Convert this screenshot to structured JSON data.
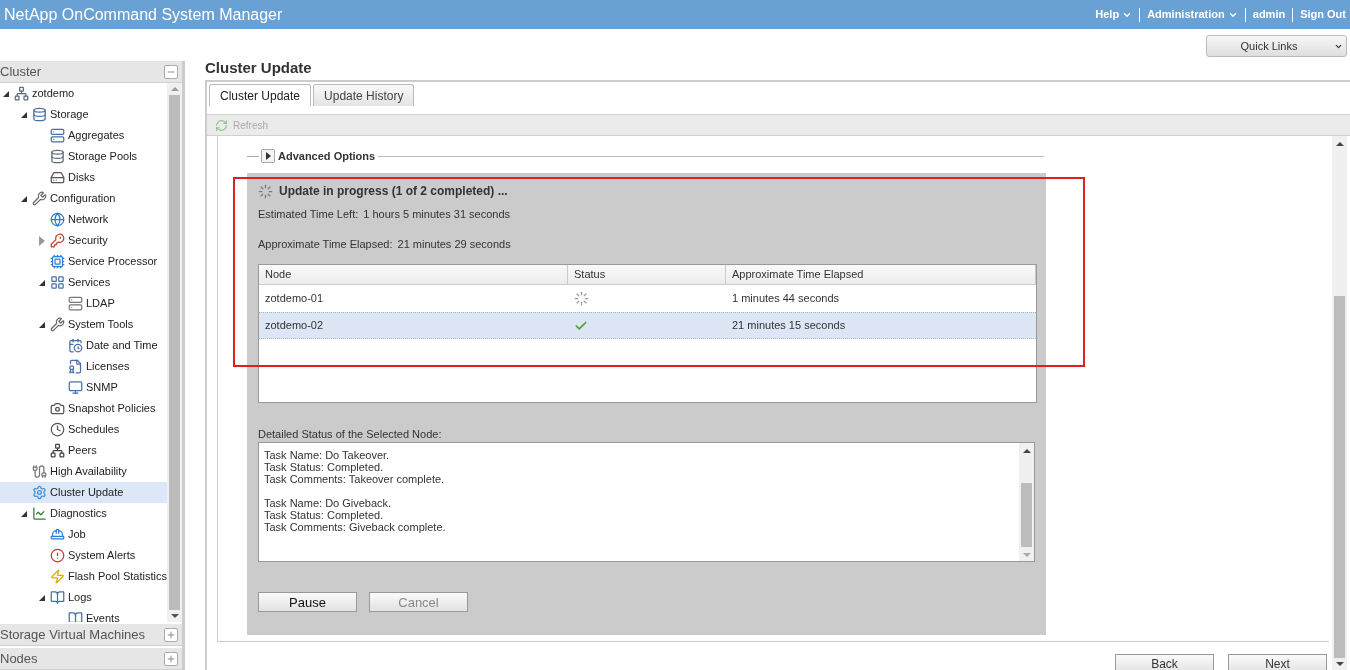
{
  "header": {
    "title": "NetApp OnCommand System Manager",
    "menus": [
      {
        "label": "Help",
        "dropdown": true
      },
      {
        "label": "Administration",
        "dropdown": true
      },
      {
        "label": "admin",
        "dropdown": false
      },
      {
        "label": "Sign Out",
        "dropdown": false
      }
    ]
  },
  "quick_links": {
    "label": "Quick Links"
  },
  "sidebar": {
    "sections": [
      {
        "title": "Cluster",
        "expanded": true
      },
      {
        "title": "Storage Virtual Machines",
        "expanded": false
      },
      {
        "title": "Nodes",
        "expanded": false
      }
    ],
    "tree": [
      {
        "label": "zotdemo",
        "selected": false,
        "expanded": true,
        "children": [
          {
            "label": "Storage",
            "selected": false,
            "expanded": true,
            "children": [
              {
                "label": "Aggregates",
                "selected": false
              },
              {
                "label": "Storage Pools",
                "selected": false
              },
              {
                "label": "Disks",
                "selected": false
              }
            ]
          },
          {
            "label": "Configuration",
            "selected": false,
            "expanded": true,
            "children": [
              {
                "label": "Network",
                "selected": false
              },
              {
                "label": "Security",
                "selected": false,
                "expanded": false
              },
              {
                "label": "Service Processor",
                "selected": false
              },
              {
                "label": "Services",
                "selected": false,
                "expanded": true,
                "children": [
                  {
                    "label": "LDAP",
                    "selected": false
                  }
                ]
              },
              {
                "label": "System Tools",
                "selected": false,
                "expanded": true,
                "children": [
                  {
                    "label": "Date and Time",
                    "selected": false
                  },
                  {
                    "label": "Licenses",
                    "selected": false
                  },
                  {
                    "label": "SNMP",
                    "selected": false
                  }
                ]
              },
              {
                "label": "Snapshot Policies",
                "selected": false
              },
              {
                "label": "Schedules",
                "selected": false
              },
              {
                "label": "Peers",
                "selected": false
              }
            ]
          },
          {
            "label": "High Availability",
            "selected": false
          },
          {
            "label": "Cluster Update",
            "selected": true
          },
          {
            "label": "Diagnostics",
            "selected": false,
            "expanded": true,
            "children": [
              {
                "label": "Job",
                "selected": false
              },
              {
                "label": "System Alerts",
                "selected": false
              },
              {
                "label": "Flash Pool Statistics",
                "selected": false
              },
              {
                "label": "Logs",
                "selected": false,
                "expanded": true,
                "children": [
                  {
                    "label": "Events",
                    "selected": false
                  }
                ]
              }
            ]
          }
        ]
      }
    ]
  },
  "page": {
    "title": "Cluster Update",
    "tabs": [
      {
        "label": "Cluster Update",
        "selected": true
      },
      {
        "label": "Update History",
        "selected": false
      }
    ],
    "toolbar": {
      "refresh": {
        "label": "Refresh",
        "disabled": true
      }
    },
    "advanced_options": {
      "label": "Advanced Options",
      "expanded": false
    },
    "progress": {
      "title": "Update in progress (1 of 2 completed) ...",
      "estimated_label": "Estimated Time Left:",
      "estimated_value": "1 hours 5 minutes 31 seconds",
      "elapsed_label": "Approximate Time Elapsed:",
      "elapsed_value": "21 minutes 29 seconds"
    },
    "table": {
      "columns": [
        "Node",
        "Status",
        "Approximate Time Elapsed"
      ],
      "rows": [
        {
          "node": "zotdemo-01",
          "kind": "running",
          "elapsed": "1 minutes 44 seconds",
          "selected": false
        },
        {
          "node": "zotdemo-02",
          "kind": "done",
          "elapsed": "21 minutes 15 seconds",
          "selected": true
        }
      ]
    },
    "details": {
      "label": "Detailed Status of the Selected Node:",
      "blocks": [
        [
          "Task Name: Do Takeover.",
          "Task Status: Completed.",
          "Task Comments: Takeover complete."
        ],
        [
          "Task Name: Do Giveback.",
          "Task Status: Completed.",
          "Task Comments: Giveback complete."
        ]
      ]
    },
    "buttons": [
      {
        "label": "Pause",
        "disabled": false
      },
      {
        "label": "Cancel",
        "disabled": true
      }
    ],
    "nav_buttons": [
      {
        "label": "Back"
      },
      {
        "label": "Next"
      }
    ]
  }
}
